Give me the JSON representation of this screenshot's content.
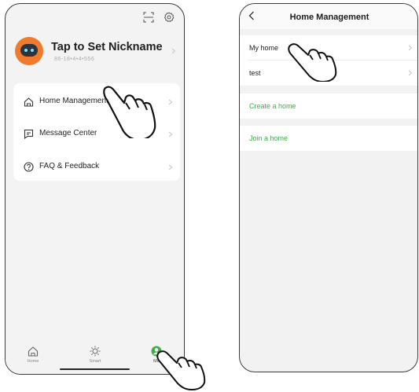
{
  "left_screen": {
    "profile": {
      "nickname": "Tap to Set Nickname",
      "account_id": "86-18•4•4•556"
    },
    "menu": [
      {
        "label": "Home Management",
        "icon": "home-icon"
      },
      {
        "label": "Message Center",
        "icon": "message-icon"
      },
      {
        "label": "FAQ & Feedback",
        "icon": "help-icon"
      }
    ],
    "tabs": [
      {
        "label": "Home",
        "icon": "home-icon"
      },
      {
        "label": "Smart",
        "icon": "sun-icon"
      },
      {
        "label": "Me",
        "icon": "user-icon",
        "active": true
      }
    ],
    "accent_color": "#3fae4a"
  },
  "right_screen": {
    "title": "Home Management",
    "homes": [
      {
        "label": "My home"
      },
      {
        "label": "test"
      }
    ],
    "actions": [
      {
        "label": "Create a home"
      },
      {
        "label": "Join a home"
      }
    ],
    "action_color": "#3fae4a"
  }
}
